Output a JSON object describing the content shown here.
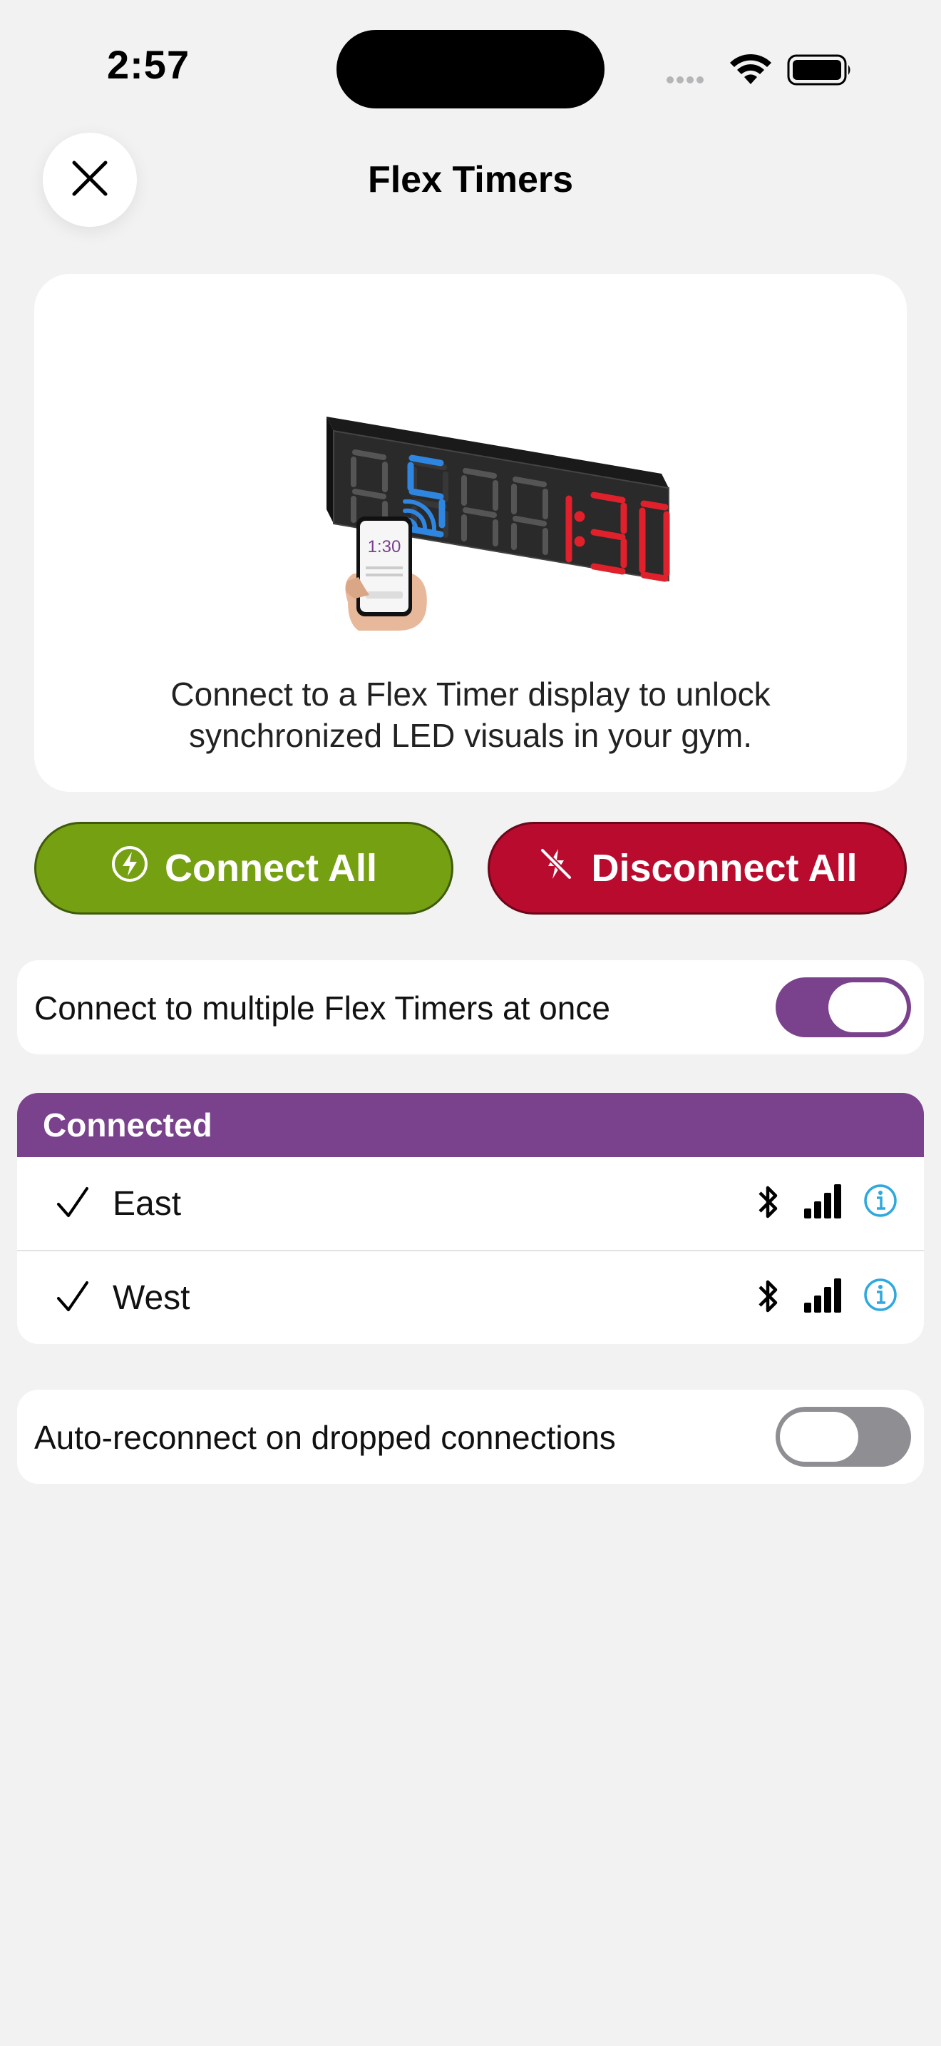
{
  "status_bar": {
    "time": "2:57",
    "icons": [
      "cellular-dots-icon",
      "wifi-icon",
      "battery-icon"
    ]
  },
  "header": {
    "title": "Flex Timers",
    "close_icon": "close-icon"
  },
  "hero": {
    "timer_display": "5:1:30",
    "phone_display": "1:30",
    "description": "Connect to a Flex Timer display to unlock synchronized LED visuals in your gym."
  },
  "actions": {
    "connect_all_label": "Connect All",
    "connect_all_icon": "bolt-circle-icon",
    "disconnect_all_label": "Disconnect All",
    "disconnect_all_icon": "bolt-slash-icon"
  },
  "multi_connect": {
    "label": "Connect to multiple Flex Timers at once",
    "enabled": true
  },
  "connected": {
    "header": "Connected",
    "devices": [
      {
        "name": "East",
        "connected": true
      },
      {
        "name": "West",
        "connected": true
      }
    ]
  },
  "auto_reconnect": {
    "label": "Auto-reconnect on dropped connections",
    "enabled": false
  },
  "colors": {
    "accent_purple": "#7a428c",
    "connect_green": "#74a012",
    "disconnect_red": "#b80b2e",
    "info_blue": "#2fa8de",
    "toggle_off": "#8e8e93"
  }
}
